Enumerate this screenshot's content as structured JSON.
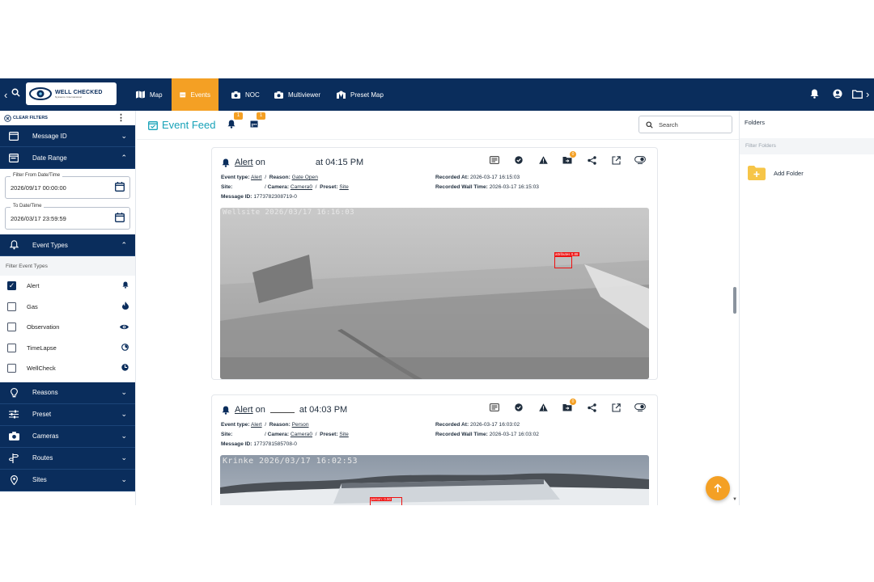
{
  "nav": {
    "items": [
      {
        "label": "Map",
        "icon": "map-icon"
      },
      {
        "label": "Events",
        "icon": "calendar-icon",
        "active": true
      },
      {
        "label": "NOC",
        "icon": "camera-icon"
      },
      {
        "label": "Multiviewer",
        "icon": "camera-icon"
      },
      {
        "label": "Preset Map",
        "icon": "map-pin-icon"
      }
    ],
    "logo_text": "WELL CHECKED",
    "logo_sub": "Systems International"
  },
  "sidebar": {
    "clear_filters": "CLEAR FILTERS",
    "message_id": "Message ID",
    "date_range": "Date Range",
    "from_label": "Filter From Date/Time",
    "from_value": "2026/09/17 00:00:00",
    "to_label": "To Date/Time",
    "to_value": "2026/03/17 23:59:59",
    "event_types": "Event Types",
    "filter_event_types": "Filter Event Types",
    "types": [
      {
        "label": "Alert",
        "checked": true,
        "icon": "bell-icon"
      },
      {
        "label": "Gas",
        "checked": false,
        "icon": "flame-icon"
      },
      {
        "label": "Observation",
        "checked": false,
        "icon": "eye-icon"
      },
      {
        "label": "TimeLapse",
        "checked": false,
        "icon": "timelapse-icon"
      },
      {
        "label": "WellCheck",
        "checked": false,
        "icon": "wellcheck-icon"
      }
    ],
    "sections": [
      "Reasons",
      "Preset",
      "Cameras",
      "Routes",
      "Sites"
    ]
  },
  "feed": {
    "title": "Event Feed",
    "bell_badge": "1",
    "calendar_badge": "1",
    "search_placeholder": "Search",
    "cards": [
      {
        "title_prefix": "Alert",
        "title_on": "on",
        "title_time": "at 04:15 PM",
        "event_type_label": "Event type:",
        "event_type": "Alert",
        "reason_label": "Reason:",
        "reason": "Gate Open",
        "site_label": "Site:",
        "camera_label": "Camera:",
        "camera": "Camera0",
        "preset_label": "Preset:",
        "preset": "Site",
        "message_label": "Message ID:",
        "message_id": "1773782308719-0",
        "recorded_label": "Recorded At:",
        "recorded_at": "2026-03-17 16:15:03",
        "wall_label": "Recorded Wall Time:",
        "wall_time": "2026-03-17 16:15:03",
        "stamp": "Wellsite 2026/03/17 16:16:03",
        "detection": "attributes 0.88",
        "folder_count": "0"
      },
      {
        "title_prefix": "Alert",
        "title_on": "on",
        "title_time": "at 04:03 PM",
        "event_type_label": "Event type:",
        "event_type": "Alert",
        "reason_label": "Reason:",
        "reason": "Person",
        "site_label": "Site:",
        "camera_label": "Camera:",
        "camera": "Camera0",
        "preset_label": "Preset:",
        "preset": "Site",
        "message_label": "Message ID:",
        "message_id": "1773781585708-0",
        "recorded_label": "Recorded At:",
        "recorded_at": "2026-03-17 16:03:02",
        "wall_label": "Recorded Wall Time:",
        "wall_time": "2026-03-17 16:03:02",
        "stamp": "Krinke 2026/03/17 16:02:53",
        "detection": "person: 0.90",
        "folder_count": "0"
      }
    ]
  },
  "folders": {
    "title": "Folders",
    "filter_placeholder": "Filter Folders",
    "add_folder": "Add Folder"
  },
  "colors": {
    "navy": "#0a2d5c",
    "accent": "#f4a024",
    "teal": "#17a2b8"
  }
}
